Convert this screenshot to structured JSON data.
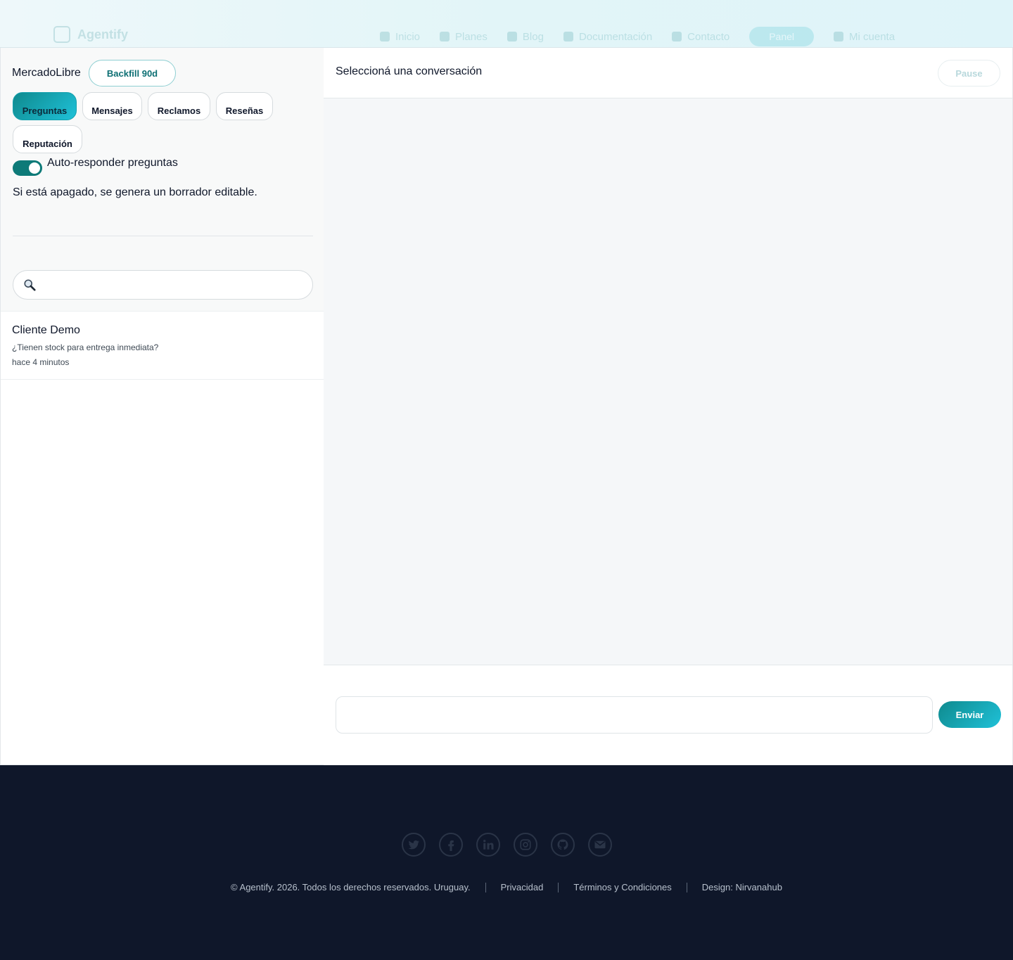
{
  "nav": {
    "brand": "Agentify",
    "items": [
      "Inicio",
      "Planes",
      "Blog",
      "Documentación",
      "Contacto"
    ],
    "cta": "Panel",
    "user": "Mi cuenta"
  },
  "sidebar": {
    "marketplace": "MercadoLibre",
    "backfill_label": "Backfill 90d",
    "tabs": [
      {
        "label": "Preguntas",
        "active": true
      },
      {
        "label": "Mensajes",
        "active": false
      },
      {
        "label": "Reclamos",
        "active": false
      },
      {
        "label": "Reseñas",
        "active": false
      },
      {
        "label": "Reputación",
        "active": false
      }
    ],
    "auto_reply_label": "Auto-responder preguntas",
    "auto_reply_on": true,
    "hint": "Si está apagado, se genera un borrador editable.",
    "search_placeholder": "",
    "conversations": [
      {
        "name": "Cliente Demo",
        "snippet": "¿Tienen stock para entrega inmediata?",
        "time": "hace 4 minutos"
      }
    ]
  },
  "chat": {
    "title": "Seleccioná una conversación",
    "pause_label": "Pause",
    "input_placeholder": "",
    "send_label": "Enviar"
  },
  "footer": {
    "socials": [
      "twitter-icon",
      "facebook-icon",
      "linkedin-icon",
      "instagram-icon",
      "github-icon",
      "mail-icon"
    ],
    "copyright": "© Agentify. 2026. Todos los derechos reservados. Uruguay.",
    "privacy": "Privacidad",
    "terms": "Términos y Condiciones",
    "design": "Design: Nirvanahub"
  },
  "colors": {
    "accent": "#0d7a78",
    "accent_light": "#1fc1d8",
    "footer_bg": "#0f172a"
  }
}
